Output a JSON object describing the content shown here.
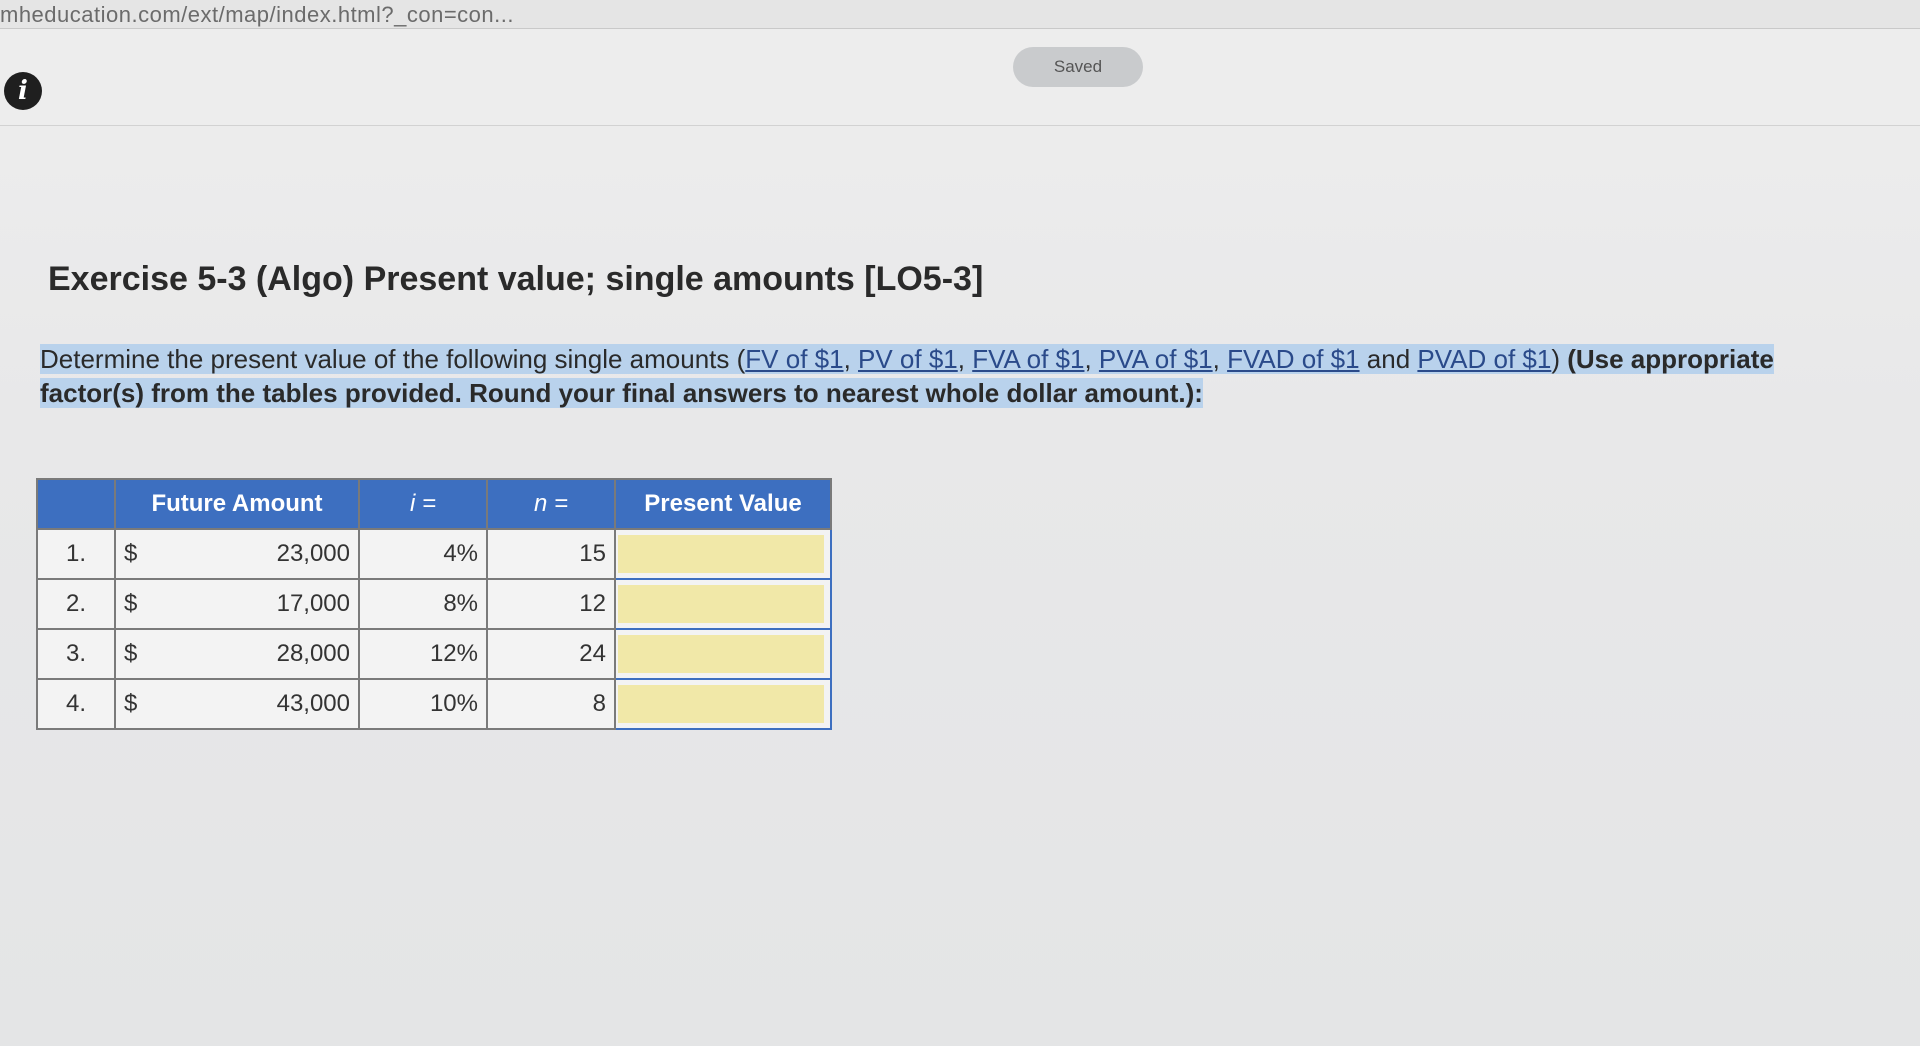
{
  "browser": {
    "url": "mheducation.com/ext/map/index.html?_con=con..."
  },
  "header": {
    "info_icon": "info-icon",
    "saved_label": "Saved"
  },
  "exercise": {
    "title": "Exercise 5-3 (Algo) Present value; single amounts [LO5-3]",
    "instructions_intro": "Determine the present value of the following single amounts (",
    "links": [
      "FV of $1",
      "PV of $1",
      "FVA of $1",
      "PVA of $1",
      "FVAD of $1",
      "PVAD of $1"
    ],
    "sep_comma": ", ",
    "sep_and": " and ",
    "instructions_mid": ") ",
    "instructions_bold": "(Use appropriate factor(s) from the tables provided. Round your final answers to nearest whole dollar amount.):"
  },
  "table": {
    "headers": {
      "blank": "",
      "future_amount": "Future Amount",
      "i": "i =",
      "n": "n =",
      "present_value": "Present Value"
    },
    "rows": [
      {
        "num": "1.",
        "currency": "$",
        "amount": "23,000",
        "rate": "4%",
        "n": "15",
        "pv": ""
      },
      {
        "num": "2.",
        "currency": "$",
        "amount": "17,000",
        "rate": "8%",
        "n": "12",
        "pv": ""
      },
      {
        "num": "3.",
        "currency": "$",
        "amount": "28,000",
        "rate": "12%",
        "n": "24",
        "pv": ""
      },
      {
        "num": "4.",
        "currency": "$",
        "amount": "43,000",
        "rate": "10%",
        "n": "8",
        "pv": ""
      }
    ]
  },
  "colors": {
    "header_blue": "#3d6fc0",
    "input_yellow": "#f1e8a8",
    "highlight": "#b9d2ec"
  }
}
